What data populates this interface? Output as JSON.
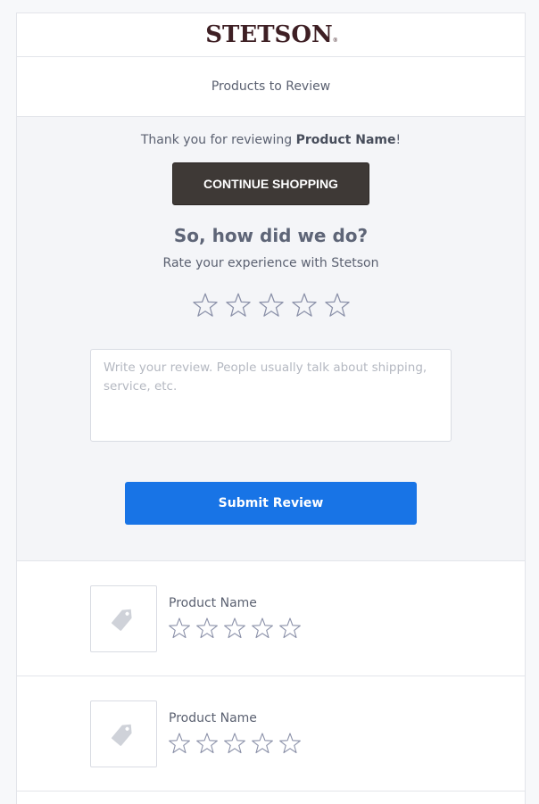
{
  "brand": {
    "logo_text": "STETSON",
    "logo_mark": "®",
    "logo_color": "#3e1f24"
  },
  "header": {
    "section_title": "Products to Review"
  },
  "hero": {
    "thanks_prefix": "Thank you for reviewing ",
    "thanks_product": "Product Name",
    "thanks_suffix": "!",
    "continue_label": "CONTINUE SHOPPING",
    "question": "So, how did we do?",
    "rate_prompt": "Rate your experience with Stetson",
    "rating": {
      "value": 0,
      "max": 5,
      "icon": "star-outline-icon"
    },
    "review_placeholder": "Write your review. People usually talk about shipping, service, etc.",
    "submit_label": "Submit Review"
  },
  "products": [
    {
      "name": "Product Name",
      "rating": 0,
      "max": 5,
      "thumb_icon": "price-tag-icon"
    },
    {
      "name": "Product Name",
      "rating": 0,
      "max": 5,
      "thumb_icon": "price-tag-icon"
    }
  ],
  "colors": {
    "accent": "#1874e6",
    "dark_button": "#3e3936",
    "star_outline": "#8a90a8",
    "background": "#f4f5f8"
  }
}
